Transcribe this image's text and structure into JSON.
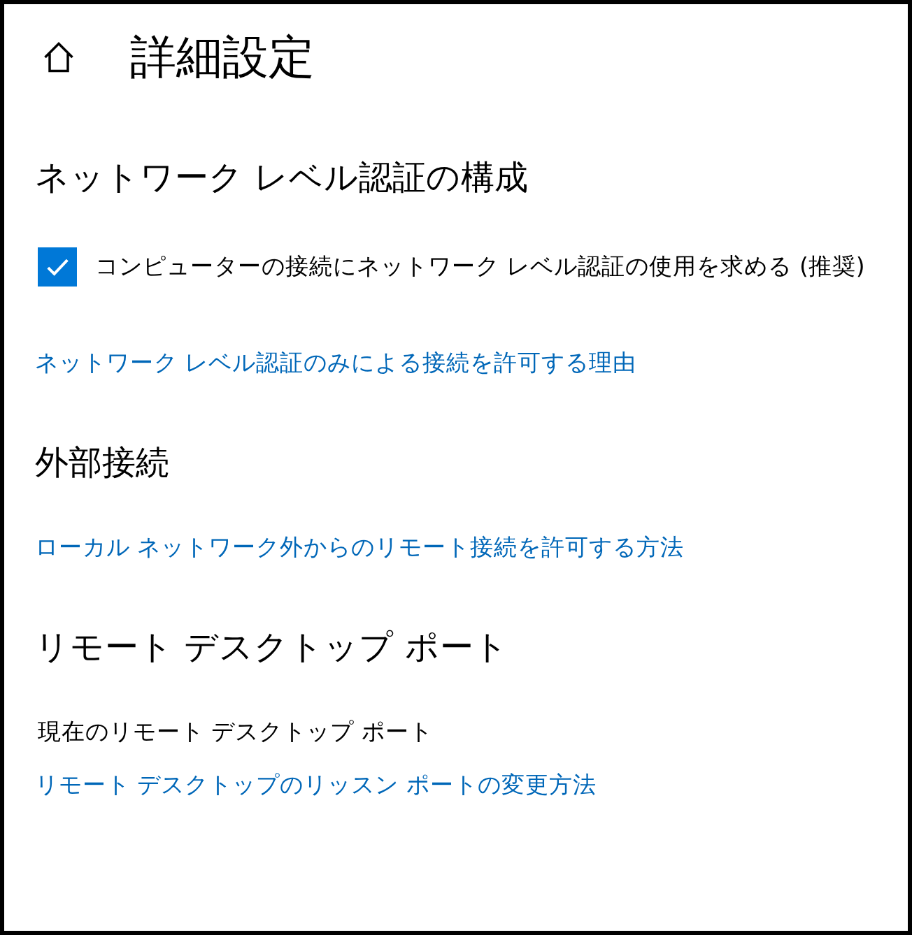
{
  "page": {
    "title": "詳細設定"
  },
  "sections": [
    {
      "heading": "ネットワーク レベル認証の構成",
      "items": [
        {
          "kind": "checkbox",
          "label": "コンピューターの接続にネットワーク レベル認証の使用を求める (推奨)",
          "checked": true
        },
        {
          "kind": "link",
          "text": "ネットワーク レベル認証のみによる接続を許可する理由"
        }
      ]
    },
    {
      "heading": "外部接続",
      "items": [
        {
          "kind": "link",
          "text": "ローカル ネットワーク外からのリモート接続を許可する方法"
        }
      ]
    },
    {
      "heading": "リモート デスクトップ ポート",
      "items": [
        {
          "kind": "text",
          "text": "現在のリモート デスクトップ ポート"
        },
        {
          "kind": "link",
          "text": "リモート デスクトップのリッスン ポートの変更方法"
        }
      ]
    }
  ]
}
